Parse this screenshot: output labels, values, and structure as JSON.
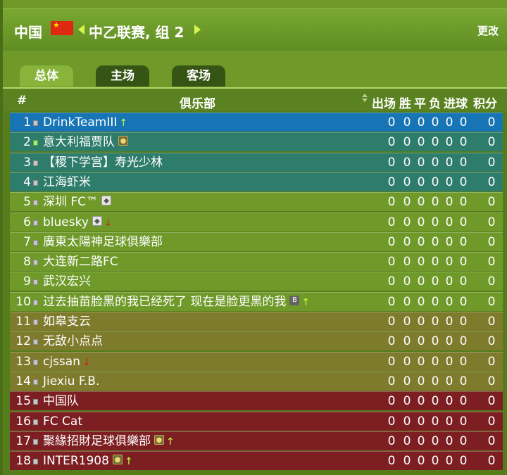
{
  "header": {
    "country": "中国",
    "league": "中乙联赛, 组 2",
    "change": "更改"
  },
  "tabs": [
    {
      "label": "总体",
      "active": true
    },
    {
      "label": "主场",
      "active": false
    },
    {
      "label": "客场",
      "active": false
    }
  ],
  "columns": {
    "rank": "#",
    "club": "俱乐部",
    "played": "出场",
    "won": "胜",
    "drawn": "平",
    "lost": "负",
    "goals": "进球",
    "points": "积分"
  },
  "zone_colors": {
    "promotion": "#1775b6",
    "playoff": "#2e7c6c",
    "safe": "#6f9a2a",
    "neutral": "#7e7b2c",
    "relegation": "#7d1f22"
  },
  "rows": [
    {
      "rank": "1",
      "name": "DrinkTeamIII",
      "icon": "up-arrow",
      "zone": "promotion",
      "stats": [
        "0",
        "0",
        "0",
        "0",
        "0",
        "0",
        "0"
      ]
    },
    {
      "rank": "2",
      "name": "意大利福贾队",
      "icon": "gold-badge",
      "zone": "playoff",
      "stats": [
        "0",
        "0",
        "0",
        "0",
        "0",
        "0",
        "0"
      ]
    },
    {
      "rank": "3",
      "name": "【稷下学宫】寿光少林",
      "icon": "",
      "zone": "playoff",
      "stats": [
        "0",
        "0",
        "0",
        "0",
        "0",
        "0",
        "0"
      ]
    },
    {
      "rank": "4",
      "name": "江海虾米",
      "icon": "",
      "zone": "playoff",
      "stats": [
        "0",
        "0",
        "0",
        "0",
        "0",
        "0",
        "0"
      ]
    },
    {
      "rank": "5",
      "name": "深圳 FC™",
      "icon": "diamond-badge",
      "zone": "safe",
      "stats": [
        "0",
        "0",
        "0",
        "0",
        "0",
        "0",
        "0"
      ]
    },
    {
      "rank": "6",
      "name": "bluesky",
      "icon": "diamond-badge-down",
      "zone": "safe",
      "stats": [
        "0",
        "0",
        "0",
        "0",
        "0",
        "0",
        "0"
      ]
    },
    {
      "rank": "7",
      "name": "廣東太陽神足球俱樂部",
      "icon": "",
      "zone": "safe",
      "stats": [
        "0",
        "0",
        "0",
        "0",
        "0",
        "0",
        "0"
      ]
    },
    {
      "rank": "8",
      "name": "大连新二路FC",
      "icon": "",
      "zone": "safe",
      "stats": [
        "0",
        "0",
        "0",
        "0",
        "0",
        "0",
        "0"
      ]
    },
    {
      "rank": "9",
      "name": "武汉宏兴",
      "icon": "",
      "zone": "safe",
      "stats": [
        "0",
        "0",
        "0",
        "0",
        "0",
        "0",
        "0"
      ]
    },
    {
      "rank": "10",
      "name": "过去抽苗脸黑的我已经死了 现在是脸更黑的我",
      "icon": "b-badge-up",
      "badge_text": "B",
      "zone": "safe",
      "stats": [
        "0",
        "0",
        "0",
        "0",
        "0",
        "0",
        "0"
      ]
    },
    {
      "rank": "11",
      "name": "如皋支云",
      "icon": "",
      "zone": "neutral",
      "stats": [
        "0",
        "0",
        "0",
        "0",
        "0",
        "0",
        "0"
      ]
    },
    {
      "rank": "12",
      "name": "无敌小点点",
      "icon": "",
      "zone": "neutral",
      "stats": [
        "0",
        "0",
        "0",
        "0",
        "0",
        "0",
        "0"
      ]
    },
    {
      "rank": "13",
      "name": "cjssan",
      "icon": "down-arrow",
      "zone": "neutral",
      "stats": [
        "0",
        "0",
        "0",
        "0",
        "0",
        "0",
        "0"
      ]
    },
    {
      "rank": "14",
      "name": "Jiexiu F.B.",
      "icon": "",
      "zone": "neutral",
      "stats": [
        "0",
        "0",
        "0",
        "0",
        "0",
        "0",
        "0"
      ]
    },
    {
      "rank": "15",
      "name": "中国队",
      "icon": "",
      "zone": "relegation",
      "stats": [
        "0",
        "0",
        "0",
        "0",
        "0",
        "0",
        "0"
      ]
    },
    {
      "rank": "16",
      "name": "FC Cat",
      "icon": "",
      "zone": "relegation",
      "stats": [
        "0",
        "0",
        "0",
        "0",
        "0",
        "0",
        "0"
      ]
    },
    {
      "rank": "17",
      "name": "聚緣招財足球俱樂部",
      "icon": "gold-badge-up",
      "zone": "relegation",
      "stats": [
        "0",
        "0",
        "0",
        "0",
        "0",
        "0",
        "0"
      ]
    },
    {
      "rank": "18",
      "name": "INTER1908",
      "icon": "gold-badge-up",
      "zone": "relegation",
      "stats": [
        "0",
        "0",
        "0",
        "0",
        "0",
        "0",
        "0"
      ]
    }
  ]
}
